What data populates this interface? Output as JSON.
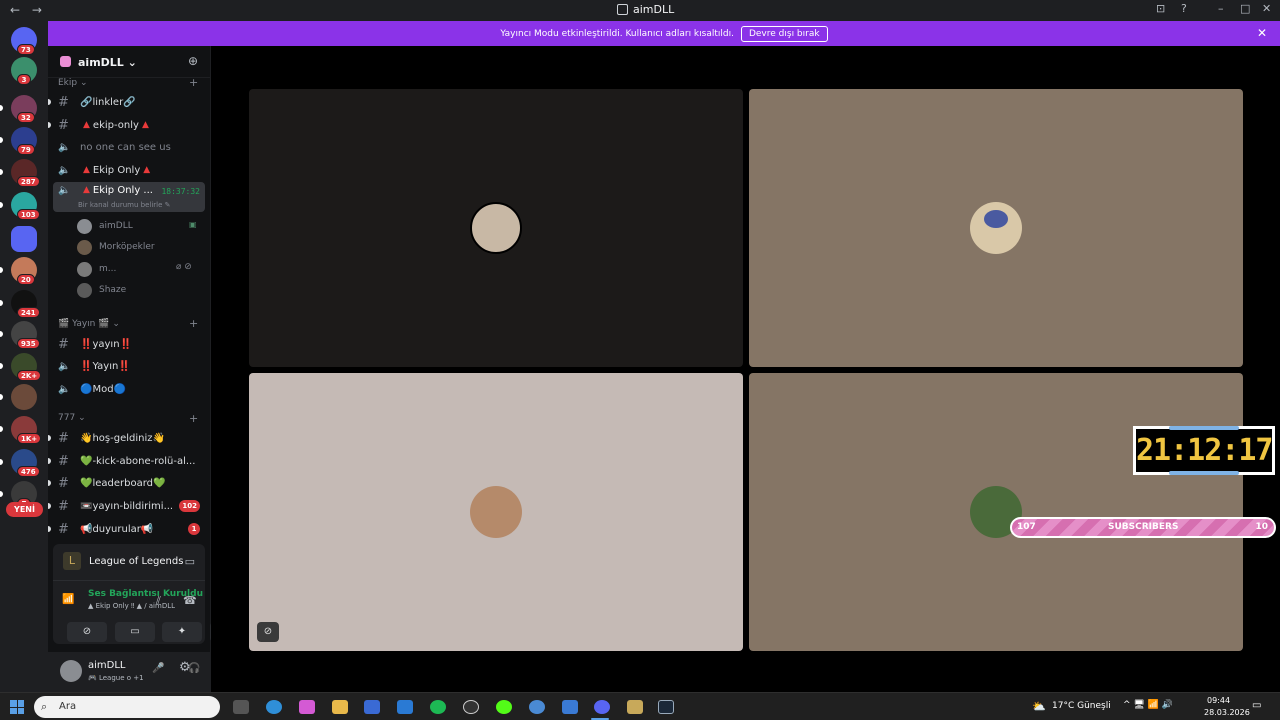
{
  "window": {
    "title": "aimDLL",
    "nav_back": "←",
    "nav_forward": "→",
    "controls": [
      "⊡",
      "?",
      "–",
      "□",
      "✕"
    ]
  },
  "banner": {
    "text": "Yayıncı Modu etkinleştirildi. Kullanıcı adları kısaltıldı.",
    "button": "Devre dışı bırak",
    "close": "✕"
  },
  "servers": [
    {
      "badge": "73",
      "color": "#5865f2"
    },
    {
      "badge": "3",
      "color": "#3b8f6c"
    },
    {
      "badge": "32",
      "color": "#7a3d5c"
    },
    {
      "badge": "79",
      "color": "#2c3e8f"
    },
    {
      "badge": "287",
      "color": "#5a2727"
    },
    {
      "badge": "103",
      "color": "#2aa7a0"
    },
    {
      "badge": "",
      "color": "#5865f2"
    },
    {
      "badge": "20",
      "color": "#c47a5a"
    },
    {
      "badge": "241",
      "color": "#111111"
    },
    {
      "badge": "935",
      "color": "#444444"
    },
    {
      "badge": "2K+",
      "color": "#3a4a2a"
    },
    {
      "badge": "",
      "color": "#6b4a3a"
    },
    {
      "badge": "1K+",
      "color": "#8a3a3a"
    },
    {
      "badge": "476",
      "color": "#2a4a8a"
    },
    {
      "badge": "7",
      "color": "#3a3a3a"
    }
  ],
  "new_label": "YENİ",
  "guild": {
    "name": "aimDLL",
    "chevron": "⌄",
    "invite_icon": "add-member-icon"
  },
  "categories": [
    {
      "name": "Ekip",
      "chevron": "⌄",
      "plus": "+"
    },
    {
      "name": "🎬 Yayın 🎬",
      "chevron": "⌄",
      "plus": "+"
    },
    {
      "name": "777",
      "chevron": "⌄",
      "plus": "+"
    }
  ],
  "channels": {
    "linkler": {
      "icon": "#",
      "label": "🔗linkler🔗"
    },
    "ekip_only": {
      "icon": "#",
      "label": "ekip-only",
      "tri": "▲"
    },
    "no_one": {
      "icon": "🔈",
      "label": "no one can see us"
    },
    "ekip_only_voice": {
      "icon": "🔈",
      "label": "Ekip Only",
      "tri": "▲"
    },
    "ekip_only_active": {
      "icon": "🔈",
      "label": "Ekip Only ...",
      "tri": "▲",
      "timer": "18:37:32",
      "status": "Bir kanal durumu belirle ✎"
    },
    "yayin1": {
      "icon": "#",
      "label": "‼️yayın‼️"
    },
    "yayin2": {
      "icon": "🔈",
      "label": "‼️Yayın‼️"
    },
    "mod": {
      "icon": "🔈",
      "label": "🔵Mod🔵"
    },
    "hos": {
      "icon": "#",
      "label": "👋hoş-geldiniz👋"
    },
    "kick": {
      "icon": "#",
      "label": "💚-kick-abone-rolü-al..."
    },
    "leader": {
      "icon": "#",
      "label": "💚leaderboard💚"
    },
    "yayin_bild": {
      "icon": "#",
      "label": "📼yayın-bildirimi...",
      "badge": "102"
    },
    "duyurular": {
      "icon": "#",
      "label": "📢duyurular📢",
      "badge": "1"
    }
  },
  "members": [
    {
      "name": "aimDLL",
      "color": "#8a8d92"
    },
    {
      "name": "Morköpekler",
      "color": "#6a5a4a"
    },
    {
      "name": "m...",
      "color": "#7a7a7a",
      "icons": "⌀ ⊘"
    },
    {
      "name": "Shaze",
      "color": "#5a5a5a"
    }
  ],
  "activity": {
    "game": "League of Legends",
    "voice_status": "Ses Bağlantısı Kuruldu",
    "voice_channel": "▲ Ekip Only ‼ ▲  / aimDLL",
    "buttons": [
      "⊘",
      "▭",
      "✦",
      "✧"
    ]
  },
  "user": {
    "name": "aimDLL",
    "status": "🎮 League o +1",
    "mic": "🎤",
    "headset": "🎧",
    "settings": "⚙"
  },
  "tiles": [
    {
      "color": "#1c1a19",
      "avatar": "#c8b8a5"
    },
    {
      "color": "#857565",
      "avatar": "#5a6a9a"
    },
    {
      "color": "#c5bab5",
      "avatar": "#b58a6a"
    },
    {
      "color": "#857565",
      "avatar": "#4a6a3a"
    }
  ],
  "overlay": {
    "clock": "21:12:17",
    "subs_left": "107",
    "subs_label": "SUBSCRIBERS",
    "subs_right": "10"
  },
  "taskbar": {
    "search": "Ara",
    "weather": "17°C  Güneşli",
    "time": "09:44",
    "date": "28.03.2026",
    "tray": "^ 🖥 📶 🔊"
  }
}
